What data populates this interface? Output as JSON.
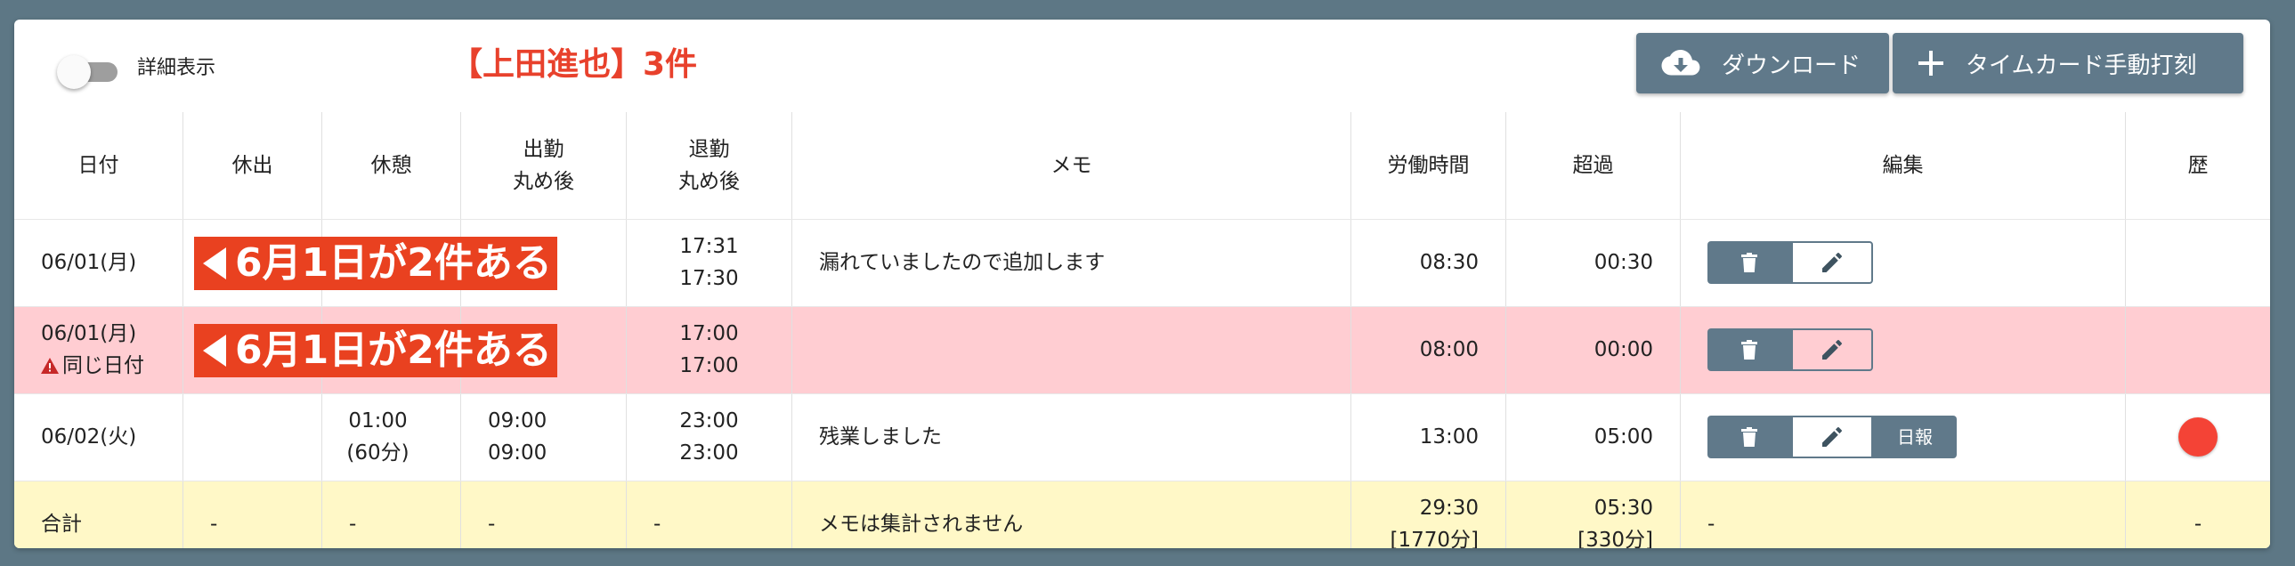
{
  "toolbar": {
    "detail_toggle_label": "詳細表示",
    "title": "【上田進也】3件",
    "download_label": "ダウンロード",
    "add_timecard_label": "タイムカード手動打刻"
  },
  "table": {
    "headers": {
      "date": "日付",
      "kyushutsu": "休出",
      "rest": "休憩",
      "in_line1": "出勤",
      "in_line2": "丸め後",
      "out_line1": "退勤",
      "out_line2": "丸め後",
      "memo": "メモ",
      "work": "労働時間",
      "over": "超過",
      "edit": "編集",
      "history": "歴"
    },
    "rows": [
      {
        "date": "06/01(月)",
        "warning": "",
        "kyushutsu": "",
        "rest_line1": "",
        "rest_line2": "",
        "in_line1": "",
        "in_line2": "",
        "out_line1": "17:31",
        "out_line2": "17:30",
        "memo": "漏れていましたので追加します",
        "work": "08:30",
        "over": "00:30",
        "has_report": false
      },
      {
        "date": "06/01(月)",
        "warning": "同じ日付",
        "kyushutsu": "",
        "rest_line1": "",
        "rest_line2": "",
        "in_line1": "",
        "in_line2": "",
        "out_line1": "17:00",
        "out_line2": "17:00",
        "memo": "",
        "work": "08:00",
        "over": "00:00",
        "has_report": false
      },
      {
        "date": "06/02(火)",
        "warning": "",
        "kyushutsu": "",
        "rest_line1": "01:00",
        "rest_line2": "(60分)",
        "in_line1": "09:00",
        "in_line2": "09:00",
        "out_line1": "23:00",
        "out_line2": "23:00",
        "memo": "残業しました",
        "work": "13:00",
        "over": "05:00",
        "report_label": "日報",
        "has_report": true
      }
    ],
    "total": {
      "label": "合計",
      "kyushutsu": "-",
      "rest": "-",
      "in": "-",
      "out": "-",
      "memo": "メモは集計されません",
      "work_line1": "29:30",
      "work_line2": "[1770分]",
      "over_line1": "05:30",
      "over_line2": "[330分]",
      "edit": "-",
      "history": "-"
    }
  },
  "annotation": {
    "text": "6月1日が2件ある"
  },
  "colors": {
    "accent_button": "#60798a",
    "title_red": "#e8412c",
    "duplicate_row": "#ffcdd2",
    "total_row": "#fff8c7",
    "history_dot": "#f44336",
    "annotation_bg": "#e94120"
  }
}
